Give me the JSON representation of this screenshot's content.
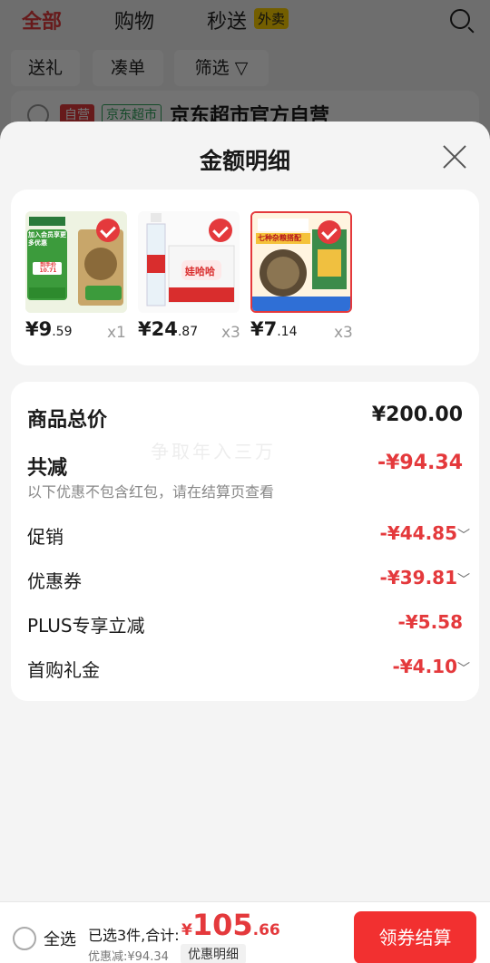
{
  "background": {
    "tabs": [
      "全部",
      "购物",
      "秒送"
    ],
    "tab_badge": "外卖",
    "chips": [
      "送礼",
      "凑单",
      "筛选"
    ],
    "store_badge_self": "自营",
    "store_badge_market": "京东超市",
    "store_name": "京东超市官方自营"
  },
  "sheet": {
    "title": "金额明细",
    "products": [
      {
        "yuan": "¥9",
        "cents": ".59",
        "qty": "x1",
        "caption": "加入会员享更多优惠",
        "promo": "到手价 10.71"
      },
      {
        "yuan": "¥24",
        "cents": ".87",
        "qty": "x3",
        "caption": "娃哈哈"
      },
      {
        "yuan": "¥7",
        "cents": ".14",
        "qty": "x3",
        "caption": "七种杂粮搭配"
      }
    ],
    "total_label": "商品总价",
    "total_value": "¥200.00",
    "discount_label": "共减",
    "discount_value": "-¥94.34",
    "discount_note": "以下优惠不包含红包，请在结算页查看",
    "breakdown": [
      {
        "label": "促销",
        "value": "-¥44.85"
      },
      {
        "label": "优惠券",
        "value": "-¥39.81"
      },
      {
        "label": "PLUS专享立减",
        "value": "-¥5.58"
      },
      {
        "label": "首购礼金",
        "value": "-¥4.10"
      }
    ],
    "watermark": "争取年入三万"
  },
  "bottom": {
    "select_all": "全选",
    "selected_text": "已选3件,合计:",
    "total_symbol": "¥",
    "total_int": "105",
    "total_dec": ".66",
    "discount_text": "优惠减:¥94.34",
    "detail_label": "优惠明细",
    "checkout_label": "领券结算"
  },
  "colors": {
    "accent": "#e4393c",
    "checkout": "#f23030",
    "sheet_bg": "#f4f4f4"
  }
}
